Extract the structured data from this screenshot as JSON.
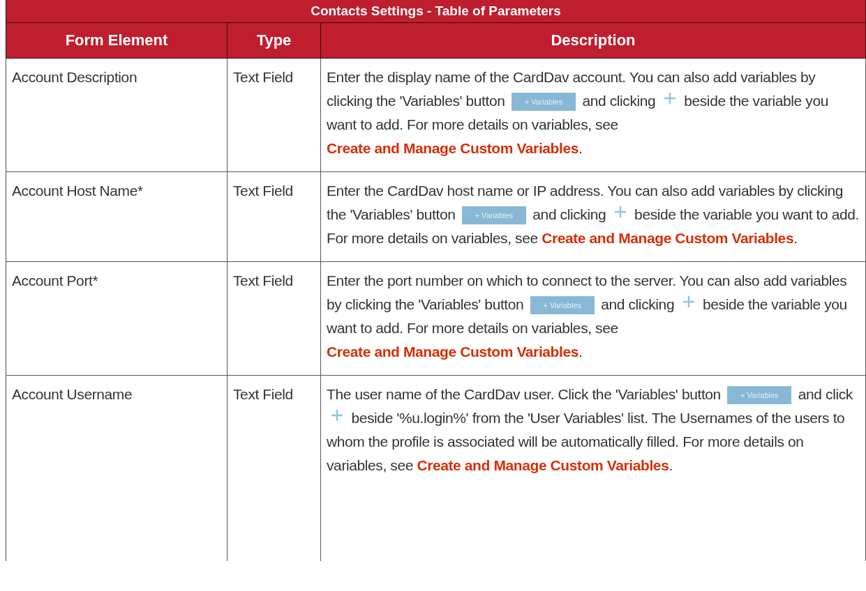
{
  "table": {
    "title": "Contacts Settings - Table of Parameters",
    "columns": [
      "Form Element",
      "Type",
      "Description"
    ],
    "rows": [
      {
        "element": "Account Description",
        "type": "Text Field",
        "description": [
          {
            "kind": "text",
            "text": "Enter the display name of the CardDav account. You can also add variables by clicking the 'Variables' button "
          },
          {
            "kind": "button",
            "text": "+ Variables"
          },
          {
            "kind": "text",
            "text": " and clicking "
          },
          {
            "kind": "plus"
          },
          {
            "kind": "text",
            "text": " beside the variable you want to add. For more details on variables, see "
          },
          {
            "kind": "link",
            "text": "Create and Manage Custom Variables"
          },
          {
            "kind": "text",
            "text": "."
          }
        ]
      },
      {
        "element": "Account Host Name*",
        "type": "Text Field",
        "description": [
          {
            "kind": "text",
            "text": "Enter the CardDav host name or IP address. You can also add variables by clicking the 'Variables' button "
          },
          {
            "kind": "button",
            "text": "+ Variables"
          },
          {
            "kind": "text",
            "text": " and clicking "
          },
          {
            "kind": "plus"
          },
          {
            "kind": "text",
            "text": " beside the variable you want to add. For more details on variables, see "
          },
          {
            "kind": "link",
            "text": "Create and Manage Custom Variables"
          },
          {
            "kind": "text",
            "text": "."
          }
        ]
      },
      {
        "element": "Account Port*",
        "type": "Text Field",
        "description": [
          {
            "kind": "text",
            "text": "Enter the port number on which to connect to the server. You can also add variables by clicking the 'Variables' button "
          },
          {
            "kind": "button",
            "text": "+ Variables"
          },
          {
            "kind": "text",
            "text": " and clicking "
          },
          {
            "kind": "plus"
          },
          {
            "kind": "text",
            "text": " beside the variable you want to add. For more details on variables, see "
          },
          {
            "kind": "link",
            "text": "Create and Manage Custom Variables"
          },
          {
            "kind": "text",
            "text": "."
          }
        ]
      },
      {
        "element": "Account Username",
        "type": "Text Field",
        "description": [
          {
            "kind": "text",
            "text": "The user name of the CardDav user. Click the 'Variables' button "
          },
          {
            "kind": "button",
            "text": "+ Variables"
          },
          {
            "kind": "text",
            "text": " and click "
          },
          {
            "kind": "plus"
          },
          {
            "kind": "text",
            "text": " beside '%u.login%' from the 'User Variables' list. The Usernames of the users to whom the profile is associated will be automatically filled. For more details on variables, see "
          },
          {
            "kind": "link",
            "text": "Create and Manage Custom Variables"
          },
          {
            "kind": "text",
            "text": "."
          }
        ]
      }
    ]
  }
}
